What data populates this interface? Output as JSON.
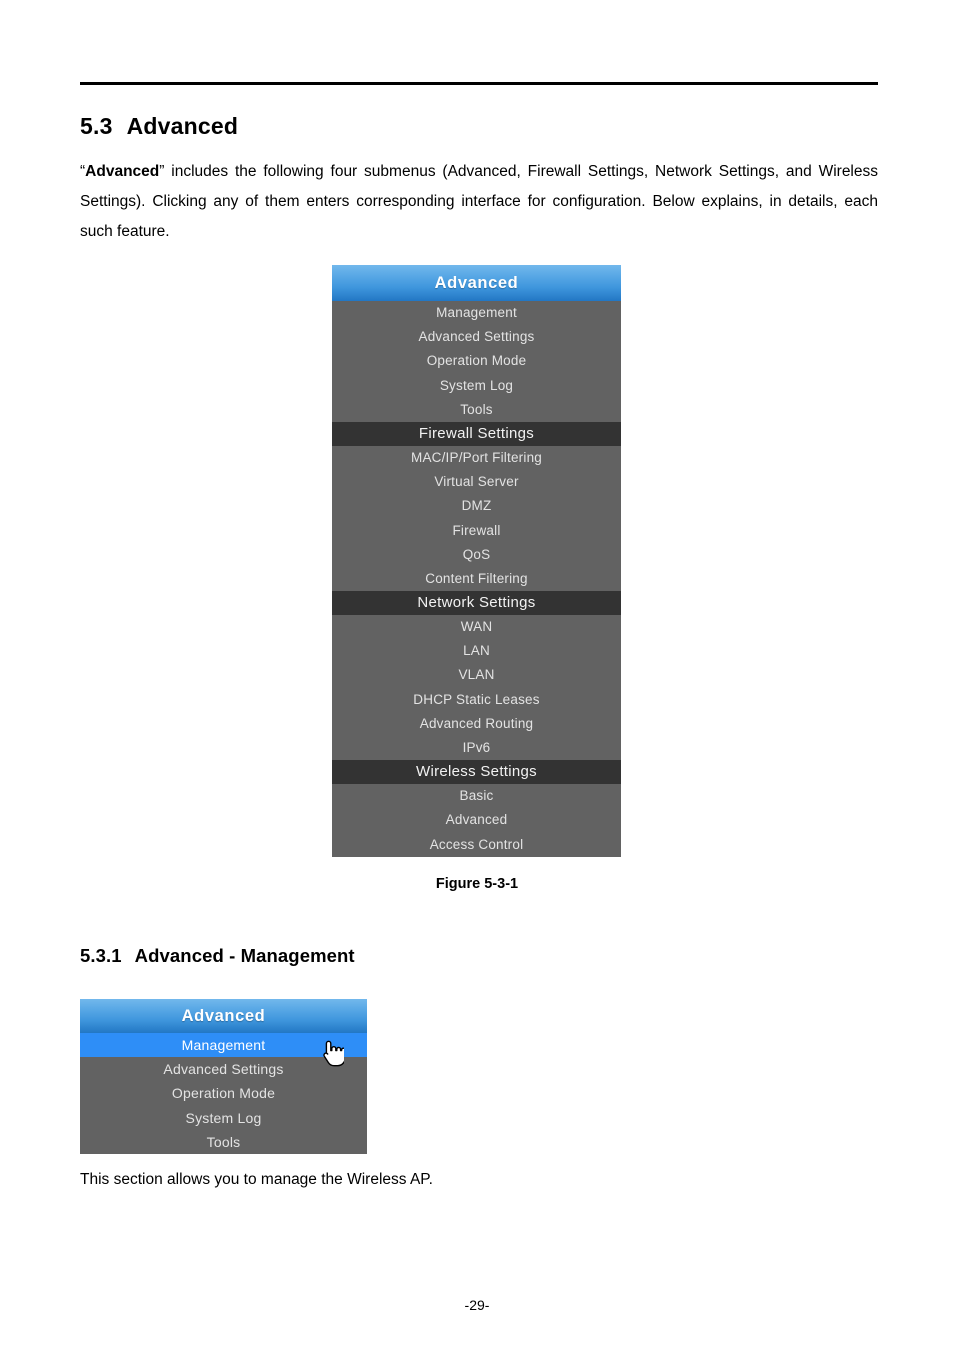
{
  "document": {
    "page_number": "-29-"
  },
  "section": {
    "number": "5.3",
    "title": "Advanced",
    "paragraph_prefix": "“",
    "paragraph_bold": "Advanced",
    "paragraph_rest": "” includes the following four submenus (Advanced, Firewall Settings, Network Settings, and Wireless Settings). Clicking any of them enters corresponding interface for configuration. Below explains, in details, each such feature."
  },
  "figure1": {
    "caption": "Figure 5-3-1",
    "title": "Advanced",
    "groups": [
      {
        "header": null,
        "items": [
          "Management",
          "Advanced Settings",
          "Operation Mode",
          "System Log",
          "Tools"
        ]
      },
      {
        "header": "Firewall Settings",
        "items": [
          "MAC/IP/Port Filtering",
          "Virtual Server",
          "DMZ",
          "Firewall",
          "QoS",
          "Content Filtering"
        ]
      },
      {
        "header": "Network Settings",
        "items": [
          "WAN",
          "LAN",
          "VLAN",
          "DHCP Static Leases",
          "Advanced Routing",
          "IPv6"
        ]
      },
      {
        "header": "Wireless Settings",
        "items": [
          "Basic",
          "Advanced",
          "Access Control"
        ]
      }
    ]
  },
  "subsection": {
    "number": "5.3.1",
    "title": "Advanced - Management",
    "body": "This section allows you to manage the Wireless AP."
  },
  "figure2": {
    "title": "Advanced",
    "items": [
      {
        "label": "Management",
        "selected": true
      },
      {
        "label": "Advanced Settings",
        "selected": false
      },
      {
        "label": "Operation Mode",
        "selected": false
      },
      {
        "label": "System Log",
        "selected": false
      },
      {
        "label": "Tools",
        "selected": false
      }
    ],
    "cursor_icon": "pointing-hand-cursor"
  },
  "colors": {
    "menu_header_blue_top": "#72b8ec",
    "menu_header_blue_bottom": "#2277c4",
    "menu_section_dark": "#333333",
    "menu_item_gray": "#626262",
    "menu_selected_blue": "#2e8ef7"
  }
}
